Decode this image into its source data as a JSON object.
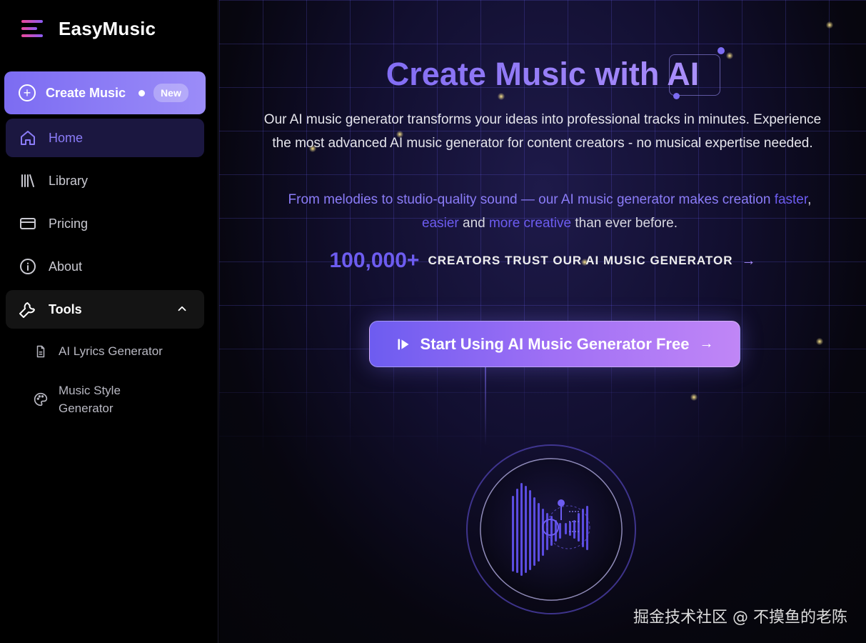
{
  "brand": {
    "name": "EasyMusic",
    "icon": "hamburger-menu-icon"
  },
  "sidebar": {
    "create_button": {
      "label": "Create Music",
      "badge": "New",
      "icon": "plus-circle-icon"
    },
    "items": [
      {
        "label": "Home",
        "icon": "home-icon",
        "active": true
      },
      {
        "label": "Library",
        "icon": "library-icon"
      },
      {
        "label": "Pricing",
        "icon": "credit-card-icon"
      },
      {
        "label": "About",
        "icon": "info-icon"
      },
      {
        "label": "Tools",
        "icon": "wrench-icon",
        "expanded": true
      }
    ],
    "tools_children": [
      {
        "label": "AI Lyrics Generator",
        "icon": "document-icon"
      },
      {
        "label": "Music Style Generator",
        "icon": "palette-icon"
      }
    ]
  },
  "hero": {
    "title": "Create Music with AI",
    "description": "Our AI music generator transforms your ideas into professional tracks in minutes. Experience the most advanced AI music generator for content creators - no musical expertise needed.",
    "subtext": {
      "part1": "From melodies to studio-quality sound — our AI music generator makes creation ",
      "hl1": "faster",
      "sep1": ",",
      "hl2": "easier",
      "and": " and ",
      "hl3": "more creative",
      "end": " than ever before."
    },
    "trust_number": "100,000+",
    "trust_text": "CREATORS TRUST OUR AI MUSIC GENERATOR",
    "trust_arrow": "→",
    "cta_label": "Start Using AI Music Generator Free",
    "cta_arrow": "→"
  },
  "watermark": "掘金技术社区 @ 不摸鱼的老陈",
  "colors": {
    "accent": "#6d5cf0",
    "accent_light": "#8b7cf8",
    "background": "#000000"
  }
}
